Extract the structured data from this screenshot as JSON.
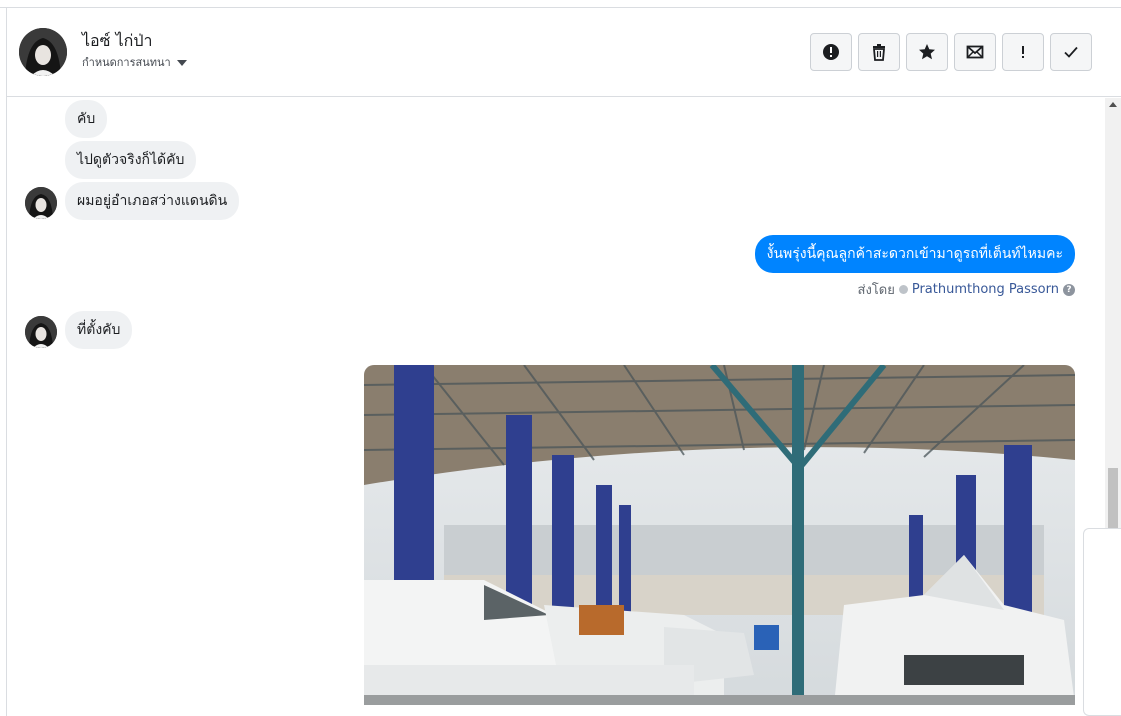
{
  "header": {
    "contact_name": "ไอซ์ ไก่ป่า",
    "conversation_settings": "กำหนดการสนทนา"
  },
  "toolbar": [
    {
      "name": "spam-button",
      "icon": "alert-circle-icon"
    },
    {
      "name": "delete-button",
      "icon": "trash-icon"
    },
    {
      "name": "star-button",
      "icon": "star-icon"
    },
    {
      "name": "mark-unread-button",
      "icon": "envelope-icon"
    },
    {
      "name": "follow-up-button",
      "icon": "exclamation-icon"
    },
    {
      "name": "mark-done-button",
      "icon": "checkmark-icon"
    }
  ],
  "messages": [
    {
      "direction": "in",
      "text": "คับ"
    },
    {
      "direction": "in",
      "text": "ไปดูตัวจริงก็ได้คับ"
    },
    {
      "direction": "in",
      "text": "ผมอยู่อำเภอสว่างแดนดิน"
    },
    {
      "direction": "out",
      "text": "งั้นพรุ่งนี้คุณลูกค้าสะดวกเข้ามาดูรถที่เต็นท์ไหมคะ"
    },
    {
      "direction": "in",
      "text": "ที่ตั้งคับ"
    },
    {
      "direction": "out",
      "type": "image",
      "alt": "car-service-garage-photo"
    }
  ],
  "sent_by": {
    "label": "ส่งโดย",
    "sender": "Prathumthong Passorn"
  },
  "colors": {
    "outgoing_bubble": "#0084ff",
    "incoming_bubble": "#eff1f3",
    "link": "#385898"
  }
}
